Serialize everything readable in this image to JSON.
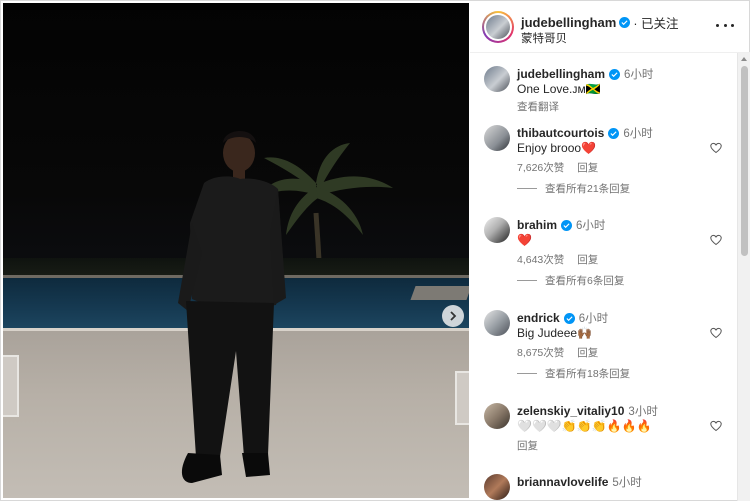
{
  "colors": {
    "accent": "#0095f6",
    "heart": "#e0245e",
    "muted": "#737373",
    "text": "#262626"
  },
  "media": {
    "next_icon": "chevron-right-icon"
  },
  "header": {
    "username": "judebellingham",
    "follow_status": "· 已关注",
    "location": "蒙特哥贝",
    "more_icon": "more-dots-icon"
  },
  "caption": {
    "username": "judebellingham",
    "time": "6小时",
    "text": "One Love.ᴊᴍ🇯🇲",
    "translate": "查看翻译"
  },
  "comments": [
    {
      "username": "thibautcourtois",
      "verified": true,
      "time": "6小时",
      "text": "Enjoy brooo❤️",
      "likes": "7,626次赞",
      "reply": "回复",
      "view_replies": "查看所有21条回复"
    },
    {
      "username": "brahim",
      "verified": true,
      "time": "6小时",
      "text": "❤️",
      "likes": "4,643次赞",
      "reply": "回复",
      "view_replies": "查看所有6条回复"
    },
    {
      "username": "endrick",
      "verified": true,
      "time": "6小时",
      "text": "Big Judeee🙌🏾",
      "likes": "8,675次赞",
      "reply": "回复",
      "view_replies": "查看所有18条回复"
    },
    {
      "username": "zelenskiy_vitaliy10",
      "verified": false,
      "time": "3小时",
      "text": "🤍🤍🤍👏👏👏🔥🔥🔥",
      "likes": "",
      "reply": "回复",
      "view_replies": ""
    },
    {
      "username": "briannavlovelife",
      "verified": false,
      "time": "5小时",
      "text": "",
      "likes": "",
      "reply": "",
      "view_replies": ""
    }
  ]
}
